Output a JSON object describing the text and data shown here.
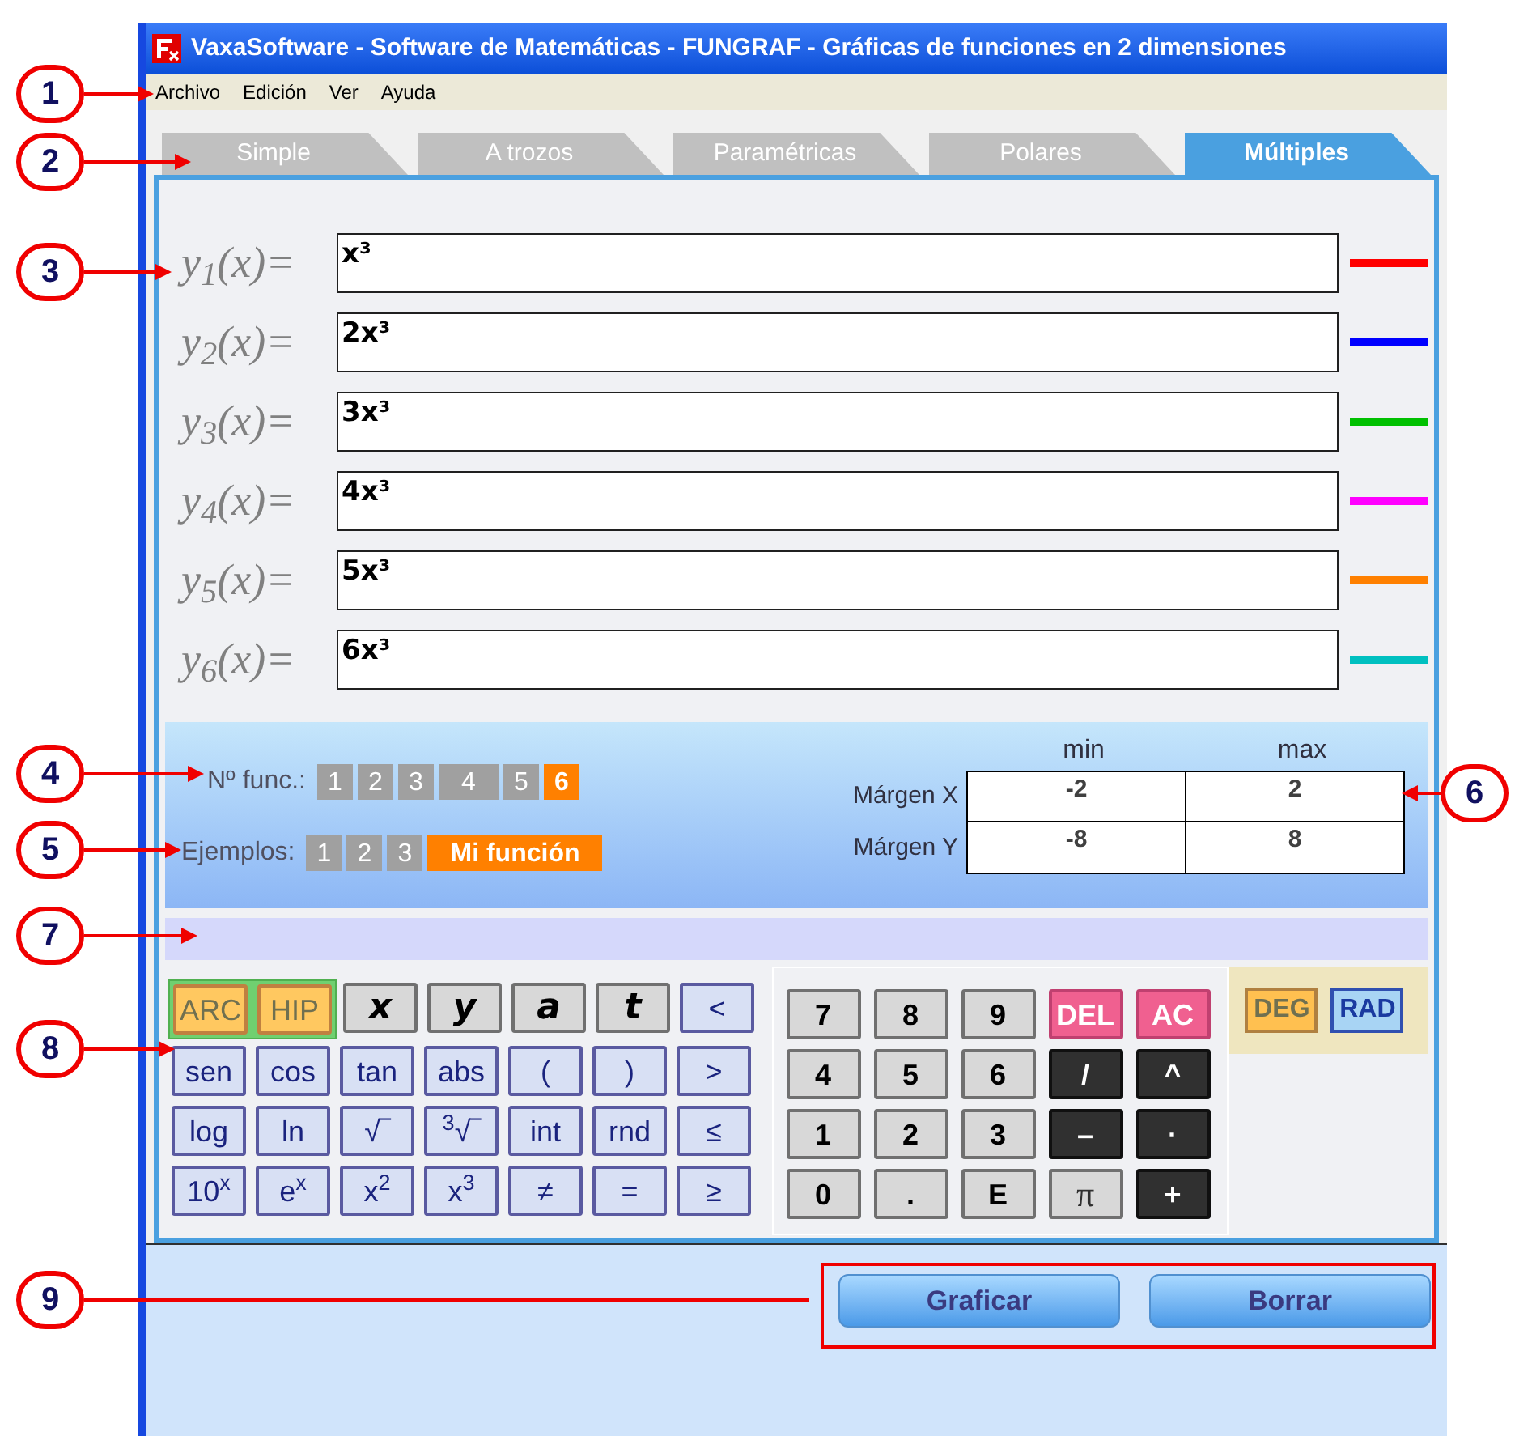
{
  "window": {
    "title": "VaxaSoftware - Software de Matemáticas - FUNGRAF - Gráficas de funciones en 2 dimensiones"
  },
  "menu": [
    "Archivo",
    "Edición",
    "Ver",
    "Ayuda"
  ],
  "tabs": [
    {
      "label": "Simple",
      "selected": false
    },
    {
      "label": "A trozos",
      "selected": false
    },
    {
      "label": "Paramétricas",
      "selected": false
    },
    {
      "label": "Polares",
      "selected": false
    },
    {
      "label": "Múltiples",
      "selected": true
    }
  ],
  "functions": [
    {
      "label": "y$_{1}$(x)=",
      "value": "x³",
      "color": "#ff0000"
    },
    {
      "label": "y$_{2}$(x)=",
      "value": "2x³",
      "color": "#0000ff"
    },
    {
      "label": "y$_{3}$(x)=",
      "value": "3x³",
      "color": "#00c000"
    },
    {
      "label": "y$_{4}$(x)=",
      "value": "4x³",
      "color": "#ff00ff"
    },
    {
      "label": "y$_{5}$(x)=",
      "value": "5x³",
      "color": "#ff8000"
    },
    {
      "label": "y$_{6}$(x)=",
      "value": "6x³",
      "color": "#00c0c0"
    }
  ],
  "count": {
    "label": "Nº func.:",
    "options": [
      {
        "label": "1",
        "selected": false
      },
      {
        "label": "2",
        "selected": false
      },
      {
        "label": "3",
        "selected": false
      },
      {
        "label": "4",
        "selected": false
      },
      {
        "label": "5",
        "selected": false
      },
      {
        "label": "6",
        "selected": true
      }
    ]
  },
  "examples": {
    "label": "Ejemplos:",
    "options": [
      {
        "label": "1",
        "selected": false
      },
      {
        "label": "2",
        "selected": false
      },
      {
        "label": "3",
        "selected": false
      },
      {
        "label": "Mi función",
        "selected": true
      }
    ]
  },
  "margins": {
    "columns": [
      "min",
      "max"
    ],
    "rows": [
      {
        "label": "Márgen X",
        "min": "-2",
        "max": "2"
      },
      {
        "label": "Márgen Y",
        "min": "-8",
        "max": "8"
      }
    ]
  },
  "keypad": {
    "functions": [
      [
        {
          "label": "ARC",
          "kind": "toggle"
        },
        {
          "label": "HIP",
          "kind": "toggle"
        },
        {
          "label": "x",
          "kind": "var"
        },
        {
          "label": "y",
          "kind": "var"
        },
        {
          "label": "a",
          "kind": "var"
        },
        {
          "label": "t",
          "kind": "var"
        },
        {
          "label": "<",
          "kind": "func"
        }
      ],
      [
        {
          "label": "sen",
          "kind": "func"
        },
        {
          "label": "cos",
          "kind": "func"
        },
        {
          "label": "tan",
          "kind": "func"
        },
        {
          "label": "abs",
          "kind": "func"
        },
        {
          "label": "(",
          "kind": "func"
        },
        {
          "label": ")",
          "kind": "func"
        },
        {
          "label": ">",
          "kind": "func"
        }
      ],
      [
        {
          "label": "log",
          "kind": "func"
        },
        {
          "label": "ln",
          "kind": "func"
        },
        {
          "label": "√‾",
          "kind": "func"
        },
        {
          "label": "$^{3}$√‾",
          "kind": "func"
        },
        {
          "label": "int",
          "kind": "func"
        },
        {
          "label": "rnd",
          "kind": "func"
        },
        {
          "label": "≤",
          "kind": "func"
        }
      ],
      [
        {
          "label": "10$^{x}$",
          "kind": "func"
        },
        {
          "label": "e$^{x}$",
          "kind": "func"
        },
        {
          "label": "x$^{2}$",
          "kind": "func"
        },
        {
          "label": "x$^{3}$",
          "kind": "func"
        },
        {
          "label": "≠",
          "kind": "func"
        },
        {
          "label": "=",
          "kind": "func"
        },
        {
          "label": "≥",
          "kind": "func"
        }
      ]
    ],
    "numbers": [
      [
        {
          "label": "7",
          "kind": "num"
        },
        {
          "label": "8",
          "kind": "num"
        },
        {
          "label": "9",
          "kind": "num"
        },
        {
          "label": "DEL",
          "kind": "clear"
        },
        {
          "label": "AC",
          "kind": "clear"
        }
      ],
      [
        {
          "label": "4",
          "kind": "num"
        },
        {
          "label": "5",
          "kind": "num"
        },
        {
          "label": "6",
          "kind": "num"
        },
        {
          "label": "/",
          "kind": "op"
        },
        {
          "label": "^",
          "kind": "op"
        }
      ],
      [
        {
          "label": "1",
          "kind": "num"
        },
        {
          "label": "2",
          "kind": "num"
        },
        {
          "label": "3",
          "kind": "num"
        },
        {
          "label": "–",
          "kind": "op"
        },
        {
          "label": "·",
          "kind": "op"
        }
      ],
      [
        {
          "label": "0",
          "kind": "num"
        },
        {
          "label": ".",
          "kind": "num"
        },
        {
          "label": "E",
          "kind": "num"
        },
        {
          "label": "π",
          "kind": "pi"
        },
        {
          "label": "+",
          "kind": "op"
        }
      ]
    ],
    "angle": [
      {
        "label": "DEG",
        "selected": true
      },
      {
        "label": "RAD",
        "selected": false
      }
    ]
  },
  "actions": [
    "Graficar",
    "Borrar"
  ],
  "callouts": [
    "1",
    "2",
    "3",
    "4",
    "6",
    "5",
    "7",
    "8",
    "9"
  ]
}
